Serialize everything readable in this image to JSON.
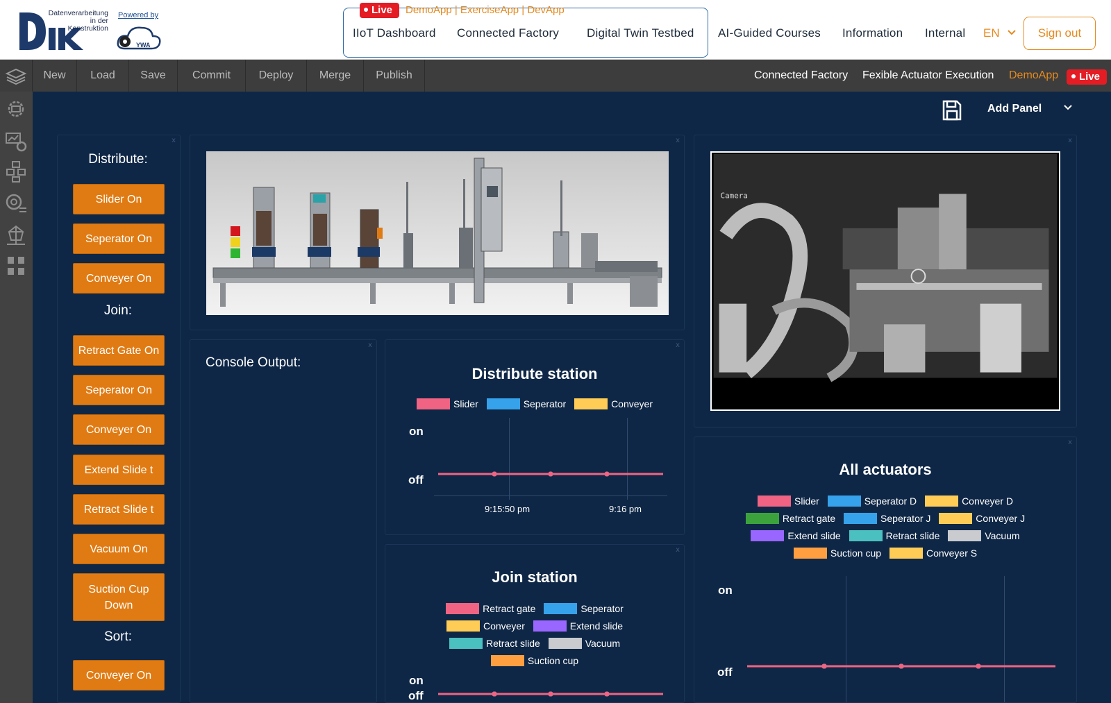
{
  "header": {
    "logo_text_lines": [
      "Datenverarbeitung",
      "in der",
      "Konstruktion"
    ],
    "powered_by": "Powered by",
    "ywa_label": "YWA",
    "live_label": "Live",
    "apps_label": "DemoApp | ExerciseApp | DevApp",
    "nav": [
      "IIoT Dashboard",
      "Connected Factory",
      "Digital Twin Testbed",
      "AI-Guided Courses",
      "Information",
      "Internal"
    ],
    "language": "EN",
    "sign_out": "Sign out"
  },
  "toolbar": {
    "buttons": [
      "New",
      "Load",
      "Save",
      "Commit",
      "Deploy",
      "Merge",
      "Publish"
    ],
    "breadcrumb_1": "Connected Factory",
    "breadcrumb_2": "Fexible Actuator Execution",
    "app": "DemoApp",
    "live_label": "Live"
  },
  "sidebar": {
    "icons": [
      "factory-settings-icon",
      "machine-chart-icon",
      "network-icon",
      "camera-settings-icon",
      "robot-arm-icon",
      "flow-blocks-icon"
    ]
  },
  "canvas": {
    "add_panel": "Add Panel",
    "controls": {
      "distribute_label": "Distribute:",
      "distribute_buttons": [
        "Slider On",
        "Seperator On",
        "Conveyer On"
      ],
      "join_label": "Join:",
      "join_buttons": [
        "Retract Gate On",
        "Seperator On",
        "Conveyer On",
        "Extend Slide t",
        "Retract Slide t",
        "Vacuum On",
        "Suction Cup Down"
      ],
      "sort_label": "Sort:",
      "sort_buttons": [
        "Conveyer On"
      ]
    },
    "console": {
      "title": "Console Output:"
    },
    "camera": {
      "overlay_text": "Camera"
    }
  },
  "chart_data": [
    {
      "type": "line",
      "title": "Distribute station",
      "series": [
        {
          "name": "Slider",
          "color": "#f06383",
          "values": [
            0,
            0,
            0,
            0,
            0
          ]
        },
        {
          "name": "Seperator",
          "color": "#36a2eb",
          "values": [
            0,
            0,
            0,
            0,
            0
          ]
        },
        {
          "name": "Conveyer",
          "color": "#ffcd56",
          "values": [
            0,
            0,
            0,
            0,
            0
          ]
        }
      ],
      "y_categories": [
        "off",
        "on"
      ],
      "x_ticks": [
        "9:15:50 pm",
        "9:16 pm"
      ]
    },
    {
      "type": "line",
      "title": "Join station",
      "series": [
        {
          "name": "Retract gate",
          "color": "#f06383",
          "values": [
            0,
            0,
            0,
            0,
            0
          ]
        },
        {
          "name": "Seperator",
          "color": "#36a2eb",
          "values": [
            0,
            0,
            0,
            0,
            0
          ]
        },
        {
          "name": "Conveyer",
          "color": "#ffcd56",
          "values": [
            0,
            0,
            0,
            0,
            0
          ]
        },
        {
          "name": "Extend slide",
          "color": "#9966ff",
          "values": [
            0,
            0,
            0,
            0,
            0
          ]
        },
        {
          "name": "Retract slide",
          "color": "#4bc0c0",
          "values": [
            0,
            0,
            0,
            0,
            0
          ]
        },
        {
          "name": "Vacuum",
          "color": "#c9cbcf",
          "values": [
            0,
            0,
            0,
            0,
            0
          ]
        },
        {
          "name": "Suction cup",
          "color": "#ff9f40",
          "values": [
            0,
            0,
            0,
            0,
            0
          ]
        }
      ],
      "y_categories": [
        "off",
        "on"
      ]
    },
    {
      "type": "line",
      "title": "All actuators",
      "series": [
        {
          "name": "Slider",
          "color": "#f06383",
          "values": [
            0,
            0,
            0,
            0,
            0
          ]
        },
        {
          "name": "Seperator D",
          "color": "#36a2eb",
          "values": [
            0,
            0,
            0,
            0,
            0
          ]
        },
        {
          "name": "Conveyer D",
          "color": "#ffcd56",
          "values": [
            0,
            0,
            0,
            0,
            0
          ]
        },
        {
          "name": "Retract gate",
          "color": "#3ca33c",
          "values": [
            0,
            0,
            0,
            0,
            0
          ]
        },
        {
          "name": "Seperator J",
          "color": "#36a2eb",
          "values": [
            0,
            0,
            0,
            0,
            0
          ]
        },
        {
          "name": "Conveyer J",
          "color": "#ffcd56",
          "values": [
            0,
            0,
            0,
            0,
            0
          ]
        },
        {
          "name": "Extend slide",
          "color": "#9966ff",
          "values": [
            0,
            0,
            0,
            0,
            0
          ]
        },
        {
          "name": "Retract slide",
          "color": "#4bc0c0",
          "values": [
            0,
            0,
            0,
            0,
            0
          ]
        },
        {
          "name": "Vacuum",
          "color": "#c9cbcf",
          "values": [
            0,
            0,
            0,
            0,
            0
          ]
        },
        {
          "name": "Suction cup",
          "color": "#ff9f40",
          "values": [
            0,
            0,
            0,
            0,
            0
          ]
        },
        {
          "name": "Conveyer S",
          "color": "#ffcd56",
          "values": [
            0,
            0,
            0,
            0,
            0
          ]
        }
      ],
      "y_categories": [
        "off",
        "on"
      ]
    }
  ]
}
